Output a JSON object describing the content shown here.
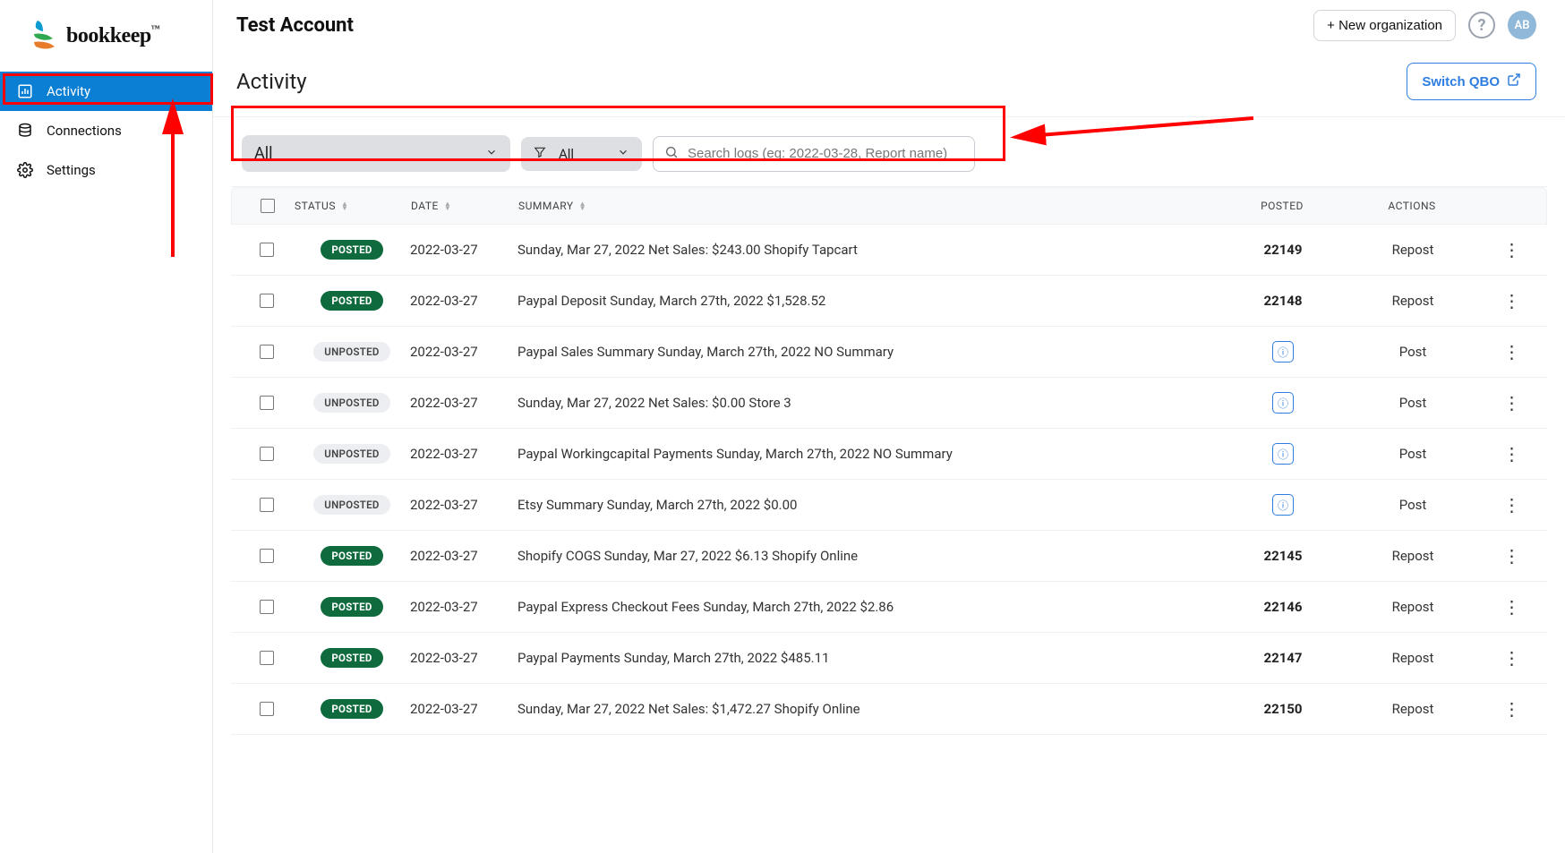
{
  "brand": {
    "name": "bookkeep",
    "tm": "™"
  },
  "sidebar": {
    "items": [
      {
        "label": "Activity",
        "icon": "chart-icon",
        "active": true
      },
      {
        "label": "Connections",
        "icon": "database-icon",
        "active": false
      },
      {
        "label": "Settings",
        "icon": "gear-icon",
        "active": false
      }
    ]
  },
  "topbar": {
    "account_title": "Test Account",
    "new_org_label": "+ New organization",
    "avatar_initials": "AB"
  },
  "page": {
    "title": "Activity",
    "switch_label": "Switch QBO"
  },
  "filters": {
    "primary": "All",
    "secondary": "All",
    "search_placeholder": "Search logs (eg: 2022-03-28, Report name)"
  },
  "table": {
    "columns": {
      "status": "STATUS",
      "date": "DATE",
      "summary": "SUMMARY",
      "posted": "POSTED",
      "actions": "ACTIONS"
    },
    "rows": [
      {
        "status": "POSTED",
        "date": "2022-03-27",
        "summary": "Sunday, Mar 27, 2022 Net Sales: $243.00 Shopify Tapcart",
        "posted": "22149",
        "action": "Repost"
      },
      {
        "status": "POSTED",
        "date": "2022-03-27",
        "summary": "Paypal Deposit Sunday, March 27th, 2022 $1,528.52",
        "posted": "22148",
        "action": "Repost"
      },
      {
        "status": "UNPOSTED",
        "date": "2022-03-27",
        "summary": "Paypal Sales Summary Sunday, March 27th, 2022 NO Summary",
        "posted": "",
        "action": "Post"
      },
      {
        "status": "UNPOSTED",
        "date": "2022-03-27",
        "summary": "Sunday, Mar 27, 2022 Net Sales: $0.00 Store 3",
        "posted": "",
        "action": "Post"
      },
      {
        "status": "UNPOSTED",
        "date": "2022-03-27",
        "summary": "Paypal Workingcapital Payments Sunday, March 27th, 2022 NO Summary",
        "posted": "",
        "action": "Post"
      },
      {
        "status": "UNPOSTED",
        "date": "2022-03-27",
        "summary": "Etsy Summary Sunday, March 27th, 2022 $0.00",
        "posted": "",
        "action": "Post"
      },
      {
        "status": "POSTED",
        "date": "2022-03-27",
        "summary": "Shopify COGS Sunday, Mar 27, 2022 $6.13 Shopify Online",
        "posted": "22145",
        "action": "Repost"
      },
      {
        "status": "POSTED",
        "date": "2022-03-27",
        "summary": "Paypal Express Checkout Fees Sunday, March 27th, 2022 $2.86",
        "posted": "22146",
        "action": "Repost"
      },
      {
        "status": "POSTED",
        "date": "2022-03-27",
        "summary": "Paypal Payments Sunday, March 27th, 2022 $485.11",
        "posted": "22147",
        "action": "Repost"
      },
      {
        "status": "POSTED",
        "date": "2022-03-27",
        "summary": "Sunday, Mar 27, 2022 Net Sales: $1,472.27 Shopify Online",
        "posted": "22150",
        "action": "Repost"
      }
    ]
  }
}
